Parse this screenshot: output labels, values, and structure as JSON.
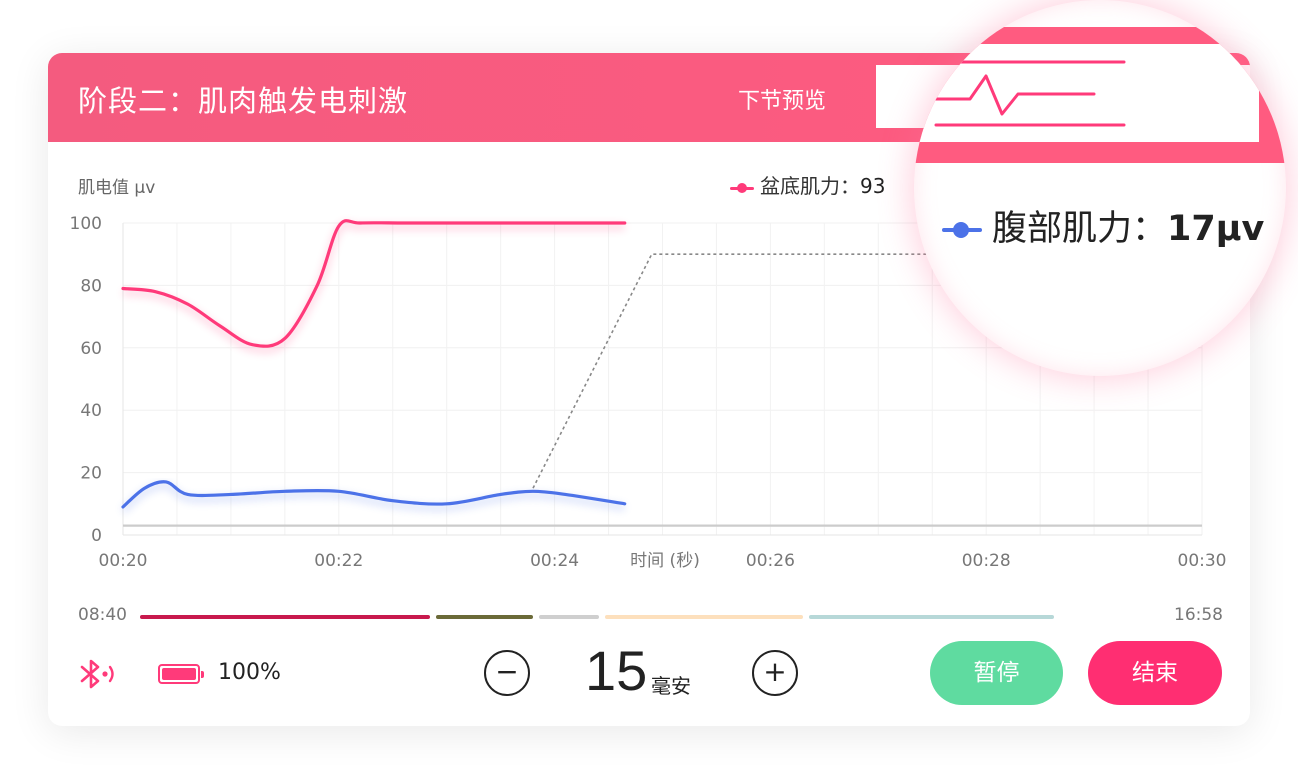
{
  "header": {
    "title": "阶段二：肌肉触发电刺激",
    "preview_label": "下节预览"
  },
  "legend": {
    "pelvic_label": "盆底肌力：",
    "pelvic_value": "93",
    "abdominal_label": "腹部肌力：",
    "abdominal_value": "17μv"
  },
  "colors": {
    "accent": "#ff5b80",
    "pelvic": "#ff3a7a",
    "abdominal": "#4c72e8",
    "pause": "#5fdba0",
    "end": "#ff2e72"
  },
  "chart_data": {
    "type": "line",
    "ylabel": "肌电值 μv",
    "xlabel": "时间 (秒)",
    "ylim": [
      0,
      100
    ],
    "y_ticks": [
      "0",
      "20",
      "40",
      "60",
      "80",
      "100"
    ],
    "x_ticks": [
      "00:20",
      "00:22",
      "00:24",
      "00:26",
      "00:28",
      "00:30"
    ],
    "series": [
      {
        "name": "盆底肌力",
        "x": [
          20.0,
          20.3,
          20.6,
          20.9,
          21.2,
          21.5,
          21.8,
          22.0,
          22.2,
          22.6,
          23.0,
          24.0,
          24.65
        ],
        "values": [
          79,
          78,
          74,
          67,
          61,
          63,
          80,
          99,
          100,
          100,
          100,
          100,
          100
        ]
      },
      {
        "name": "腹部肌力",
        "x": [
          20.0,
          20.2,
          20.4,
          20.6,
          21.0,
          21.5,
          22.0,
          22.5,
          23.0,
          23.5,
          23.8,
          24.1,
          24.65
        ],
        "values": [
          9,
          15,
          17,
          13,
          13,
          14,
          14,
          11,
          10,
          13,
          14,
          13,
          10
        ]
      }
    ],
    "target_line": {
      "x": [
        23.8,
        24.9,
        27.5
      ],
      "values": [
        15,
        90,
        90
      ]
    },
    "baseline": {
      "x": [
        20.0,
        30.0
      ],
      "values": [
        3,
        3
      ]
    }
  },
  "session": {
    "start_time": "08:40",
    "end_time": "16:58",
    "progress_segments": [
      {
        "color": "#c8194d",
        "value": 0.29
      },
      {
        "color": "#6b6a38",
        "value": 0.1
      },
      {
        "color": "#cfcfcf",
        "value": 0.065
      },
      {
        "color": "#fde0bd",
        "value": 0.2
      },
      {
        "color": "#b7d8d8",
        "value": 0.245
      }
    ]
  },
  "device": {
    "bluetooth_icon": "bluetooth-icon",
    "battery_icon": "battery-icon",
    "battery_percent": "100%",
    "battery_level": 1.0
  },
  "current": {
    "decrease_label": "−",
    "increase_label": "+",
    "value": "15",
    "unit": "毫安"
  },
  "actions": {
    "pause_label": "暂停",
    "end_label": "结束"
  }
}
